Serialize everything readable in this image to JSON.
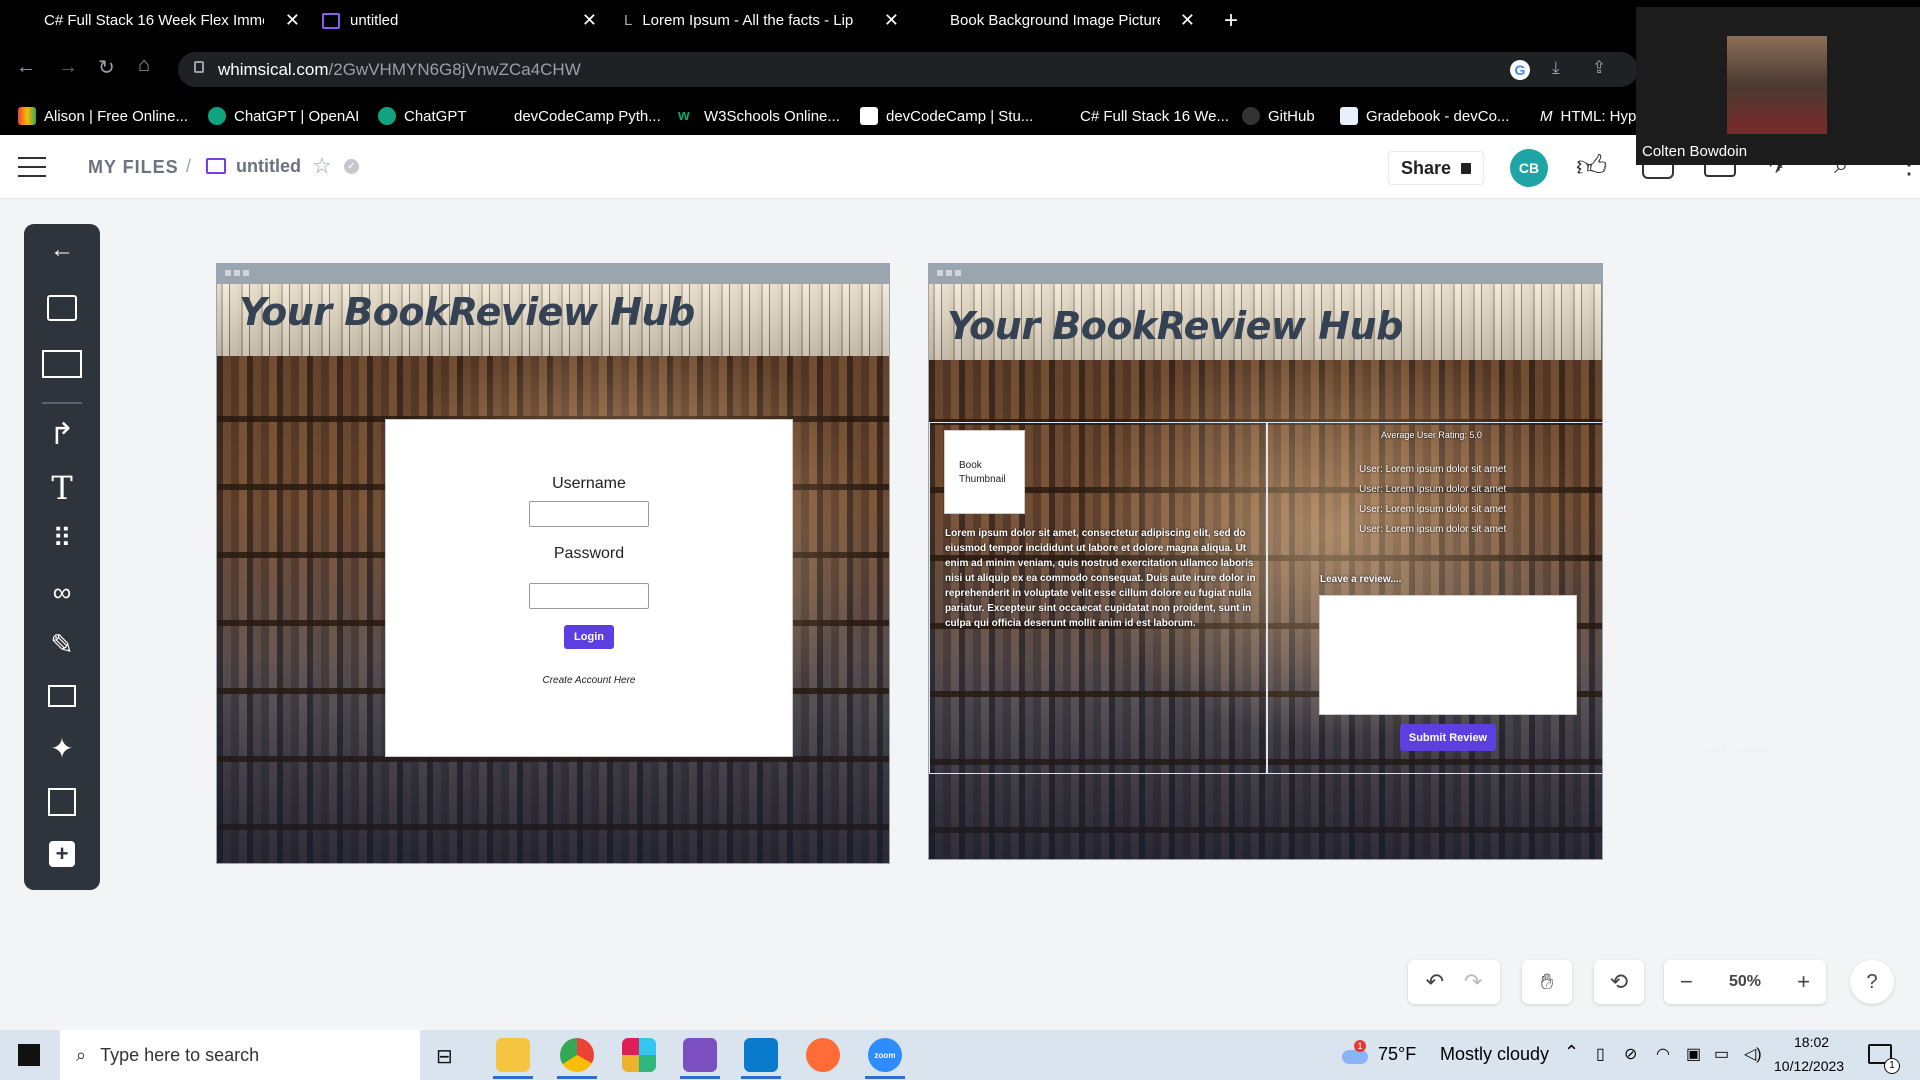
{
  "browser": {
    "tabs": [
      {
        "title": "C# Full Stack 16 Week Flex Imme"
      },
      {
        "title": "untitled"
      },
      {
        "title": "Lorem Ipsum - All the facts - Lip"
      },
      {
        "title": "Book Background Image Picture"
      }
    ],
    "new_tab_label": "+",
    "url_domain": "whimsical.com",
    "url_path": "/2GwVHMYN6G8jVnwZCa4CHW",
    "bookmarks": [
      {
        "label": "Alison | Free Online..."
      },
      {
        "label": "ChatGPT | OpenAI"
      },
      {
        "label": "ChatGPT"
      },
      {
        "label": "devCodeCamp Pyth..."
      },
      {
        "label": "W3Schools Online..."
      },
      {
        "label": "devCodeCamp | Stu..."
      },
      {
        "label": "C# Full Stack 16 We..."
      },
      {
        "label": "GitHub"
      },
      {
        "label": "Gradebook - devCo..."
      },
      {
        "label": "HTML: Hype"
      }
    ]
  },
  "app": {
    "breadcrumb_root": "MY FILES",
    "breadcrumb_sep": "/",
    "doc_title": "untitled",
    "share_label": "Share",
    "avatar_initials": "CB"
  },
  "frame1": {
    "title": "Your BookReview Hub",
    "username_label": "Username",
    "password_label": "Password",
    "login_button": "Login",
    "create_account_link": "Create Account Here"
  },
  "frame2": {
    "title": "Your BookReview Hub",
    "thumbnail_label": "Book Thumbnail",
    "description": "Lorem ipsum dolor sit amet, consectetur adipiscing elit, sed do eiusmod tempor incididunt ut labore et dolore magna aliqua. Ut enim ad minim veniam, quis nostrud exercitation ullamco laboris nisi ut aliquip ex ea commodo consequat. Duis aute irure dolor in reprehenderit in voluptate velit esse cillum dolore eu fugiat nulla pariatur. Excepteur sint occaecat cupidatat non proident, sunt in culpa qui officia deserunt mollit anim id est laborum.",
    "avg_rating": "Average User Rating: 5.0",
    "reviews": [
      "User: Lorem ipsum dolor sit amet",
      "User: Lorem ipsum dolor sit amet",
      "User: Lorem ipsum dolor sit amet",
      "User: Lorem ipsum dolor sit amet"
    ],
    "leave_review_label": "Leave a review....",
    "submit_button": "Submit Review",
    "stray_text": "Leave a review...."
  },
  "controls": {
    "zoom": "50%",
    "zoom_out": "−",
    "zoom_in": "+",
    "help": "?"
  },
  "video": {
    "participant": "Colten Bowdoin"
  },
  "taskbar": {
    "search_placeholder": "Type here to search",
    "weather_temp": "75°F",
    "weather_desc": "Mostly cloudy",
    "time": "18:02",
    "date": "10/12/2023",
    "weather_badge": "1",
    "notif_count": "1",
    "zoom_app_label": "zoom"
  }
}
